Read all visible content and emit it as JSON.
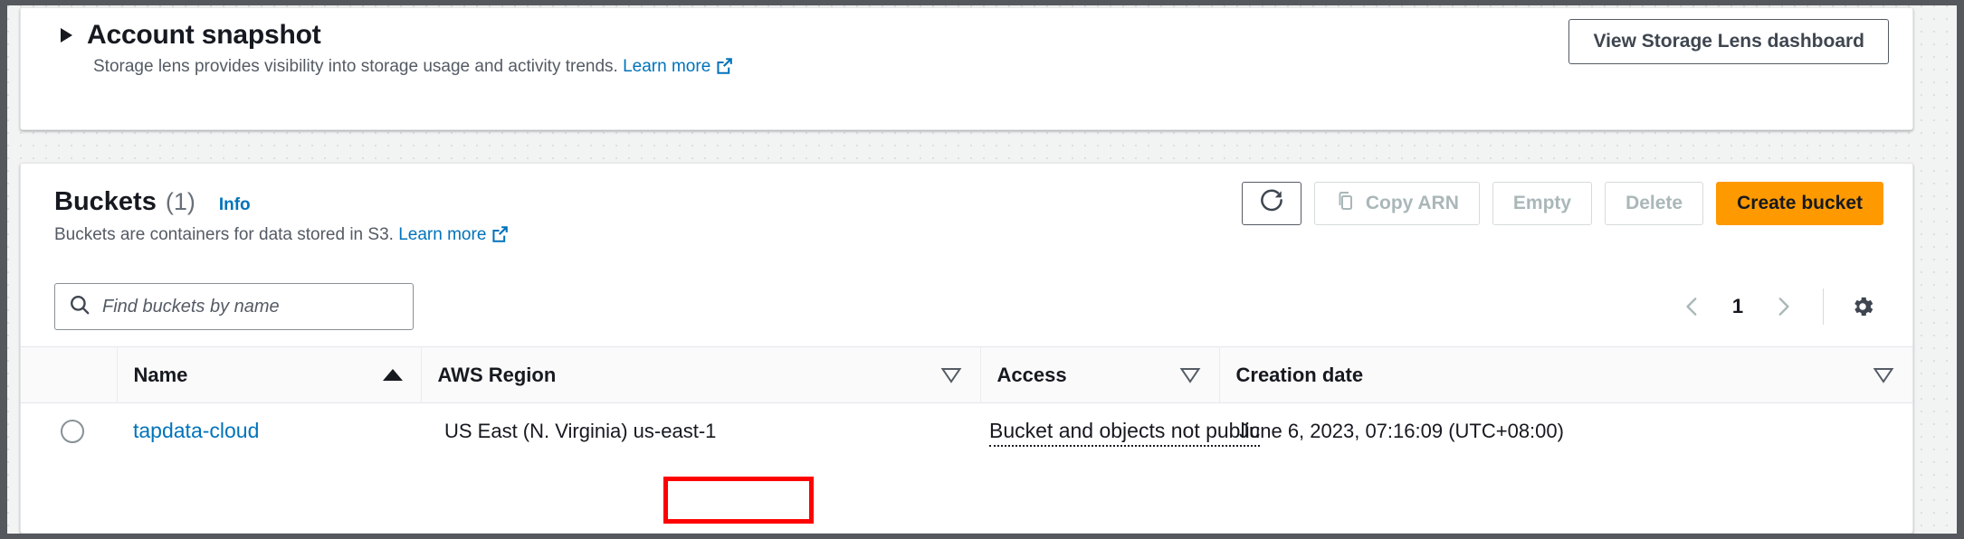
{
  "account_snapshot": {
    "title": "Account snapshot",
    "description": "Storage lens provides visibility into storage usage and activity trends.",
    "learn_more_label": "Learn more",
    "expand_icon": "disclosure-triangle-right-icon",
    "external_link_icon": "external-link-icon",
    "view_dashboard_button": "View Storage Lens dashboard"
  },
  "buckets": {
    "title": "Buckets",
    "count": "(1)",
    "info_label": "Info",
    "description": "Buckets are containers for data stored in S3.",
    "learn_more_label": "Learn more",
    "actions": {
      "refresh_icon": "refresh-icon",
      "copy_arn_label": "Copy ARN",
      "copy_icon": "copy-icon",
      "empty_label": "Empty",
      "delete_label": "Delete",
      "create_label": "Create bucket"
    },
    "search": {
      "placeholder": "Find buckets by name",
      "value": "",
      "icon": "search-icon"
    },
    "pagination": {
      "prev_icon": "chevron-left-icon",
      "page": "1",
      "next_icon": "chevron-right-icon",
      "settings_icon": "gear-icon"
    },
    "columns": [
      {
        "label": "Name",
        "sort": "asc"
      },
      {
        "label": "AWS Region",
        "sort": "none"
      },
      {
        "label": "Access",
        "sort": "none"
      },
      {
        "label": "Creation date",
        "sort": "none"
      }
    ],
    "rows": [
      {
        "name": "tapdata-cloud",
        "region_name": "US East (N. Virginia)",
        "region_code": "us-east-1",
        "access": "Bucket and objects not public",
        "creation_date": "June 6, 2023, 07:16:09 (UTC+08:00)"
      }
    ]
  },
  "annotation": {
    "highlight_target": "us-east-1",
    "highlight_color": "#ff0000"
  },
  "colors": {
    "link": "#0073bb",
    "primary_button": "#ff9900",
    "text": "#16191f",
    "muted_text": "#545b64",
    "canvas": "#f2f3f3"
  }
}
